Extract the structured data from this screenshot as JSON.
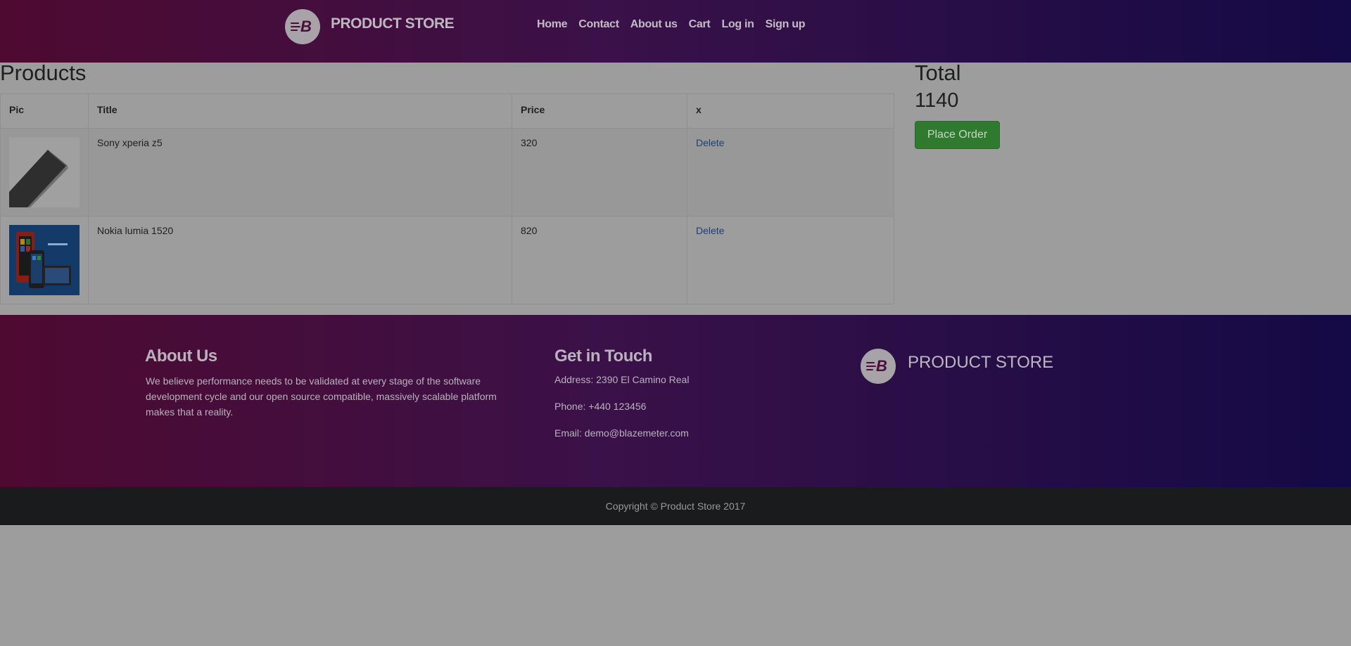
{
  "navbar": {
    "brand": "PRODUCT STORE",
    "links": [
      "Home",
      "Contact",
      "About us",
      "Cart",
      "Log in",
      "Sign up"
    ]
  },
  "products": {
    "title": "Products",
    "columns": [
      "Pic",
      "Title",
      "Price",
      "x"
    ],
    "rows": [
      {
        "title": "Sony xperia z5",
        "price": "320",
        "action": "Delete"
      },
      {
        "title": "Nokia lumia 1520",
        "price": "820",
        "action": "Delete"
      }
    ]
  },
  "summary": {
    "label": "Total",
    "value": "1140",
    "button": "Place Order"
  },
  "footer": {
    "about_title": "About Us",
    "about_text": "We believe performance needs to be validated at every stage of the software development cycle and our open source compatible, massively scalable platform makes that a reality.",
    "touch_title": "Get in Touch",
    "address": "Address: 2390 El Camino Real",
    "phone": "Phone: +440 123456",
    "email": "Email: demo@blazemeter.com",
    "brand": "PRODUCT STORE",
    "copyright": "Copyright © Product Store 2017"
  },
  "colors": {
    "nav_gradient_start": "#4e0a31",
    "nav_gradient_end": "#140a45",
    "place_order_button": "#2f7a2f",
    "delete_link": "#1c3f79"
  },
  "icons": {
    "brand_logo": "blazemeter-b-logo-icon"
  }
}
